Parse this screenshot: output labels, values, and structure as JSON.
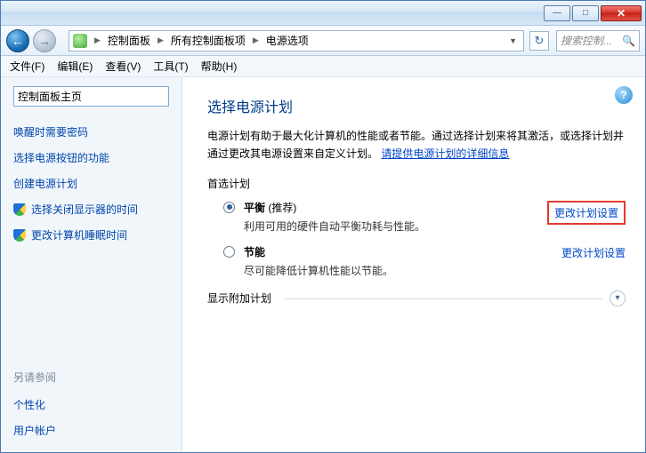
{
  "window_buttons": {
    "min": "—",
    "max": "□",
    "close": "✕"
  },
  "nav": {
    "back": "←",
    "forward": "→"
  },
  "breadcrumb": {
    "sep": "▶",
    "items": [
      "控制面板",
      "所有控制面板项",
      "电源选项"
    ],
    "dropdown_glyph": "▼",
    "refresh_glyph": "↻"
  },
  "search": {
    "placeholder": "搜索控制...",
    "icon": "🔍"
  },
  "menu": {
    "file": "文件(F)",
    "edit": "编辑(E)",
    "view": "查看(V)",
    "tools": "工具(T)",
    "help": "帮助(H)"
  },
  "help_glyph": "?",
  "sidebar": {
    "home": "控制面板主页",
    "links": [
      "唤醒时需要密码",
      "选择电源按钮的功能",
      "创建电源计划"
    ],
    "shield_links": [
      "选择关闭显示器的时间",
      "更改计算机睡眠时间"
    ],
    "see_also_heading": "另请参阅",
    "see_also": [
      "个性化",
      "用户帐户"
    ]
  },
  "main": {
    "title": "选择电源计划",
    "desc_a": "电源计划有助于最大化计算机的性能或者节能。通过选择计划来将其激活，或选择计划并通过更改其电源设置来自定义计划。",
    "desc_link": "请提供电源计划的详细信息",
    "preferred_heading": "首选计划",
    "plans": [
      {
        "name": "平衡",
        "rec": " (推荐)",
        "sub": "利用可用的硬件自动平衡功耗与性能。",
        "selected": true,
        "highlight": true
      },
      {
        "name": "节能",
        "rec": "",
        "sub": "尽可能降低计算机性能以节能。",
        "selected": false,
        "highlight": false
      }
    ],
    "change_link": "更改计划设置",
    "expand_label": "显示附加计划",
    "chevron": "▾"
  }
}
